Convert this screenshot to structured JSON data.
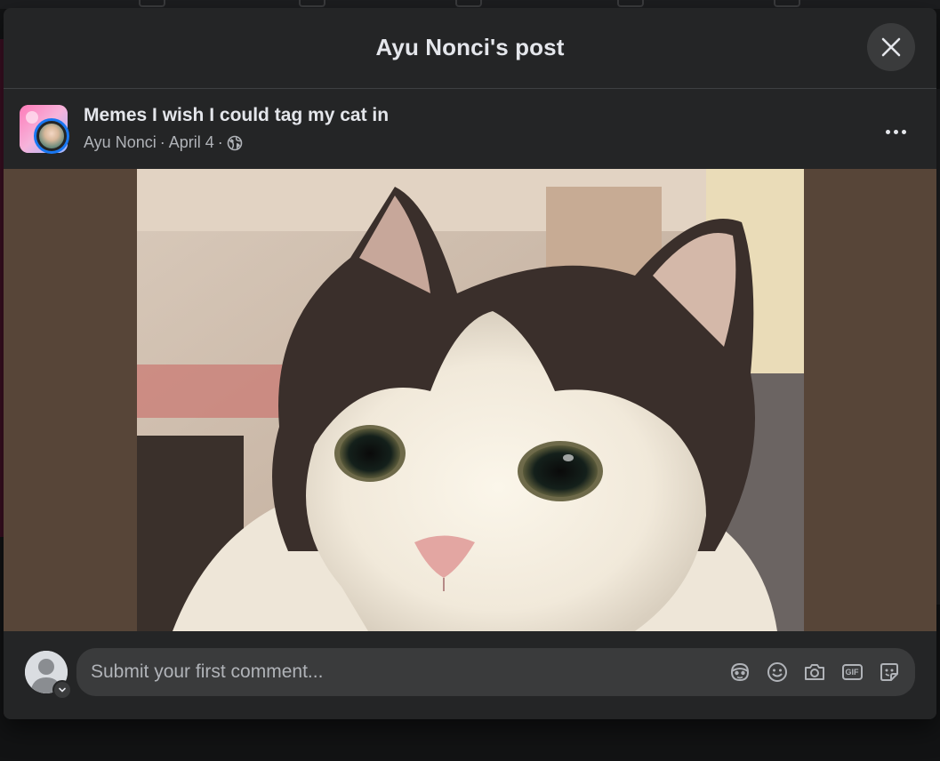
{
  "modal": {
    "title": "Ayu Nonci's post",
    "close_label": "Close"
  },
  "post": {
    "group_name": "Memes I wish I could tag my cat in",
    "author": "Ayu Nonci",
    "separator": "·",
    "date": "April 4",
    "audience_icon": "globe-icon",
    "more_icon": "more-options-icon"
  },
  "media": {
    "subject": "cat photo",
    "letterbox_color": "#574538"
  },
  "comment": {
    "placeholder": "Submit your first comment...",
    "tools": [
      "avatar-sticker-icon",
      "emoji-icon",
      "camera-icon",
      "gif-icon",
      "sticker-icon"
    ],
    "gif_label": "GIF"
  },
  "colors": {
    "modal_bg": "#242526",
    "accent": "#1877f2",
    "text_primary": "#e4e6eb",
    "text_secondary": "#b0b3b8"
  }
}
